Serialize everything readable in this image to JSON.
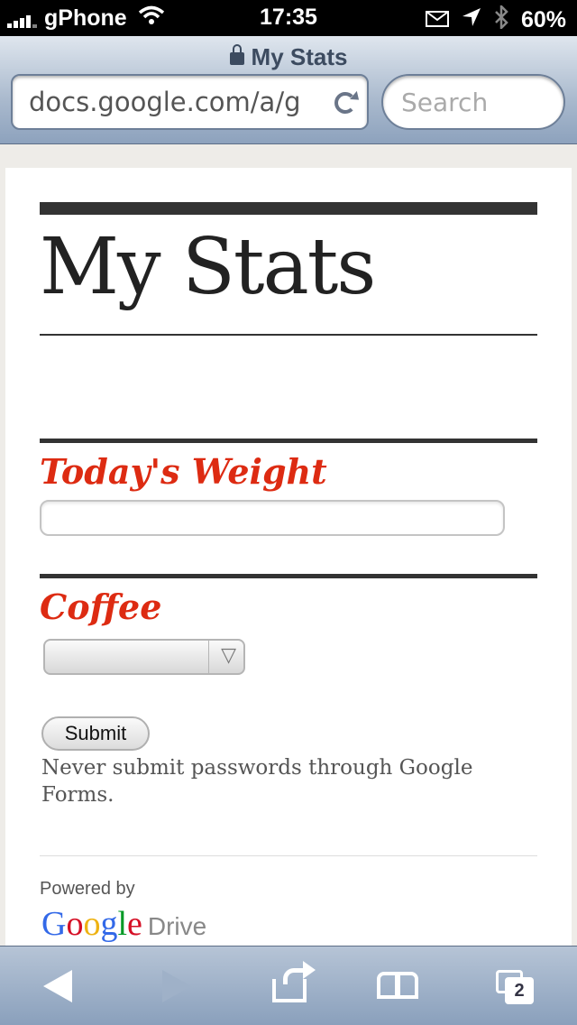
{
  "status_bar": {
    "carrier": "gPhone",
    "time": "17:35",
    "battery": "60%"
  },
  "browser": {
    "page_title": "My Stats",
    "url": "docs.google.com/a/g",
    "search_placeholder": "Search"
  },
  "form": {
    "title": "My Stats",
    "questions": [
      {
        "label": "Today's Weight",
        "value": ""
      },
      {
        "label": "Coffee",
        "selected": ""
      }
    ],
    "submit_label": "Submit",
    "warning": "Never submit passwords through Google Forms.",
    "powered_by": "Powered by",
    "drive_label": "Drive"
  },
  "toolbar": {
    "tab_count": "2"
  }
}
